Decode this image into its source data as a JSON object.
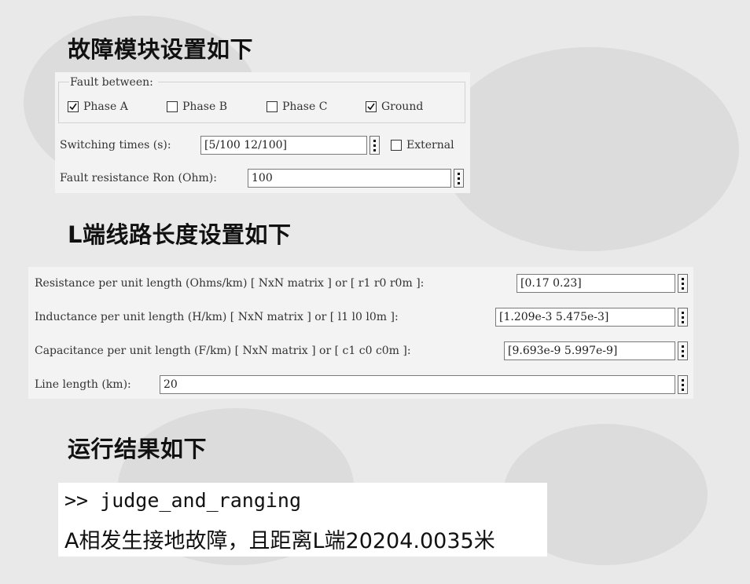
{
  "headings": {
    "fault_module": "故障模块设置如下",
    "line_length": "L端线路长度设置如下",
    "results": "运行结果如下"
  },
  "fault_block": {
    "legend": "Fault between:",
    "checkboxes": [
      {
        "label": "Phase A",
        "checked": true
      },
      {
        "label": "Phase B",
        "checked": false
      },
      {
        "label": "Phase C",
        "checked": false
      },
      {
        "label": "Ground",
        "checked": true
      }
    ],
    "switching_times": {
      "label": "Switching times (s):",
      "value": "[5/100 12/100]"
    },
    "external": {
      "label": "External",
      "checked": false
    },
    "fault_resistance": {
      "label": "Fault resistance Ron (Ohm):",
      "value": "100"
    }
  },
  "line_block": {
    "resistance": {
      "label": "Resistance per unit length (Ohms/km) [ NxN matrix ] or [ r1 r0 r0m ]:",
      "value": "[0.17 0.23]"
    },
    "inductance": {
      "label": "Inductance per unit length (H/km) [ NxN matrix ] or [ l1 l0 l0m ]:",
      "value": "[1.209e-3  5.475e-3]"
    },
    "capacitance": {
      "label": "Capacitance per unit length (F/km) [ NxN matrix ] or [ c1 c0 c0m ]:",
      "value": "[9.693e-9 5.997e-9]"
    },
    "line_length": {
      "label": "Line length (km):",
      "value": "20"
    }
  },
  "console": {
    "command": ">> judge_and_ranging",
    "output": "A相发生接地故障，且距离L端20204.0035米"
  }
}
